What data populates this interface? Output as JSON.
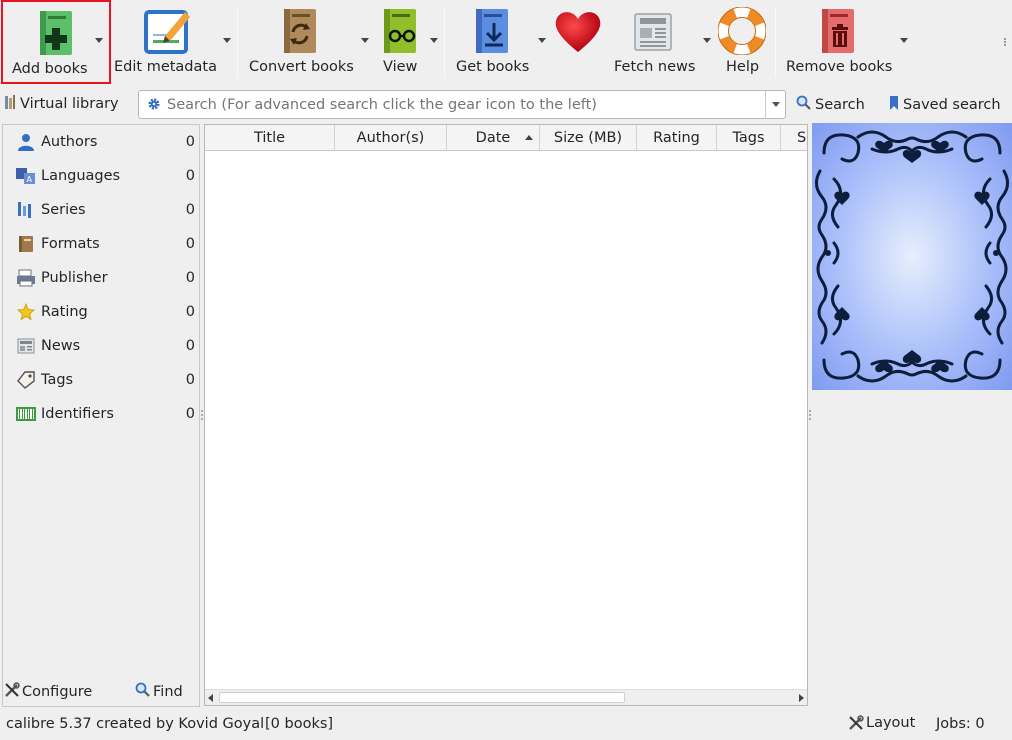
{
  "toolbar": {
    "add_books": "Add books",
    "edit_metadata": "Edit metadata",
    "convert_books": "Convert books",
    "view": "View",
    "get_books": "Get books",
    "fetch_news": "Fetch news",
    "help": "Help",
    "remove_books": "Remove books"
  },
  "search": {
    "virtual_library": "Virtual library",
    "placeholder": "Search (For advanced search click the gear icon to the left)",
    "search_button": "Search",
    "saved_search": "Saved search"
  },
  "tag_browser": {
    "items": [
      {
        "label": "Authors",
        "count": "0",
        "icon": "person-icon"
      },
      {
        "label": "Languages",
        "count": "0",
        "icon": "languages-icon"
      },
      {
        "label": "Series",
        "count": "0",
        "icon": "series-icon"
      },
      {
        "label": "Formats",
        "count": "0",
        "icon": "book-icon"
      },
      {
        "label": "Publisher",
        "count": "0",
        "icon": "publisher-icon"
      },
      {
        "label": "Rating",
        "count": "0",
        "icon": "star-icon"
      },
      {
        "label": "News",
        "count": "0",
        "icon": "news-icon"
      },
      {
        "label": "Tags",
        "count": "0",
        "icon": "tag-icon"
      },
      {
        "label": "Identifiers",
        "count": "0",
        "icon": "barcode-icon"
      }
    ],
    "configure": "Configure",
    "find": "Find"
  },
  "book_list": {
    "columns": [
      "Title",
      "Author(s)",
      "Date",
      "Size (MB)",
      "Rating",
      "Tags",
      "Se"
    ]
  },
  "status": {
    "app": "calibre 5.37 created by Kovid Goyal",
    "books": "[0 books]",
    "layout": "Layout",
    "jobs": "Jobs: 0"
  },
  "colors": {
    "selection_outline": "#e5141e",
    "cover_blue": "#8aa4f2"
  }
}
